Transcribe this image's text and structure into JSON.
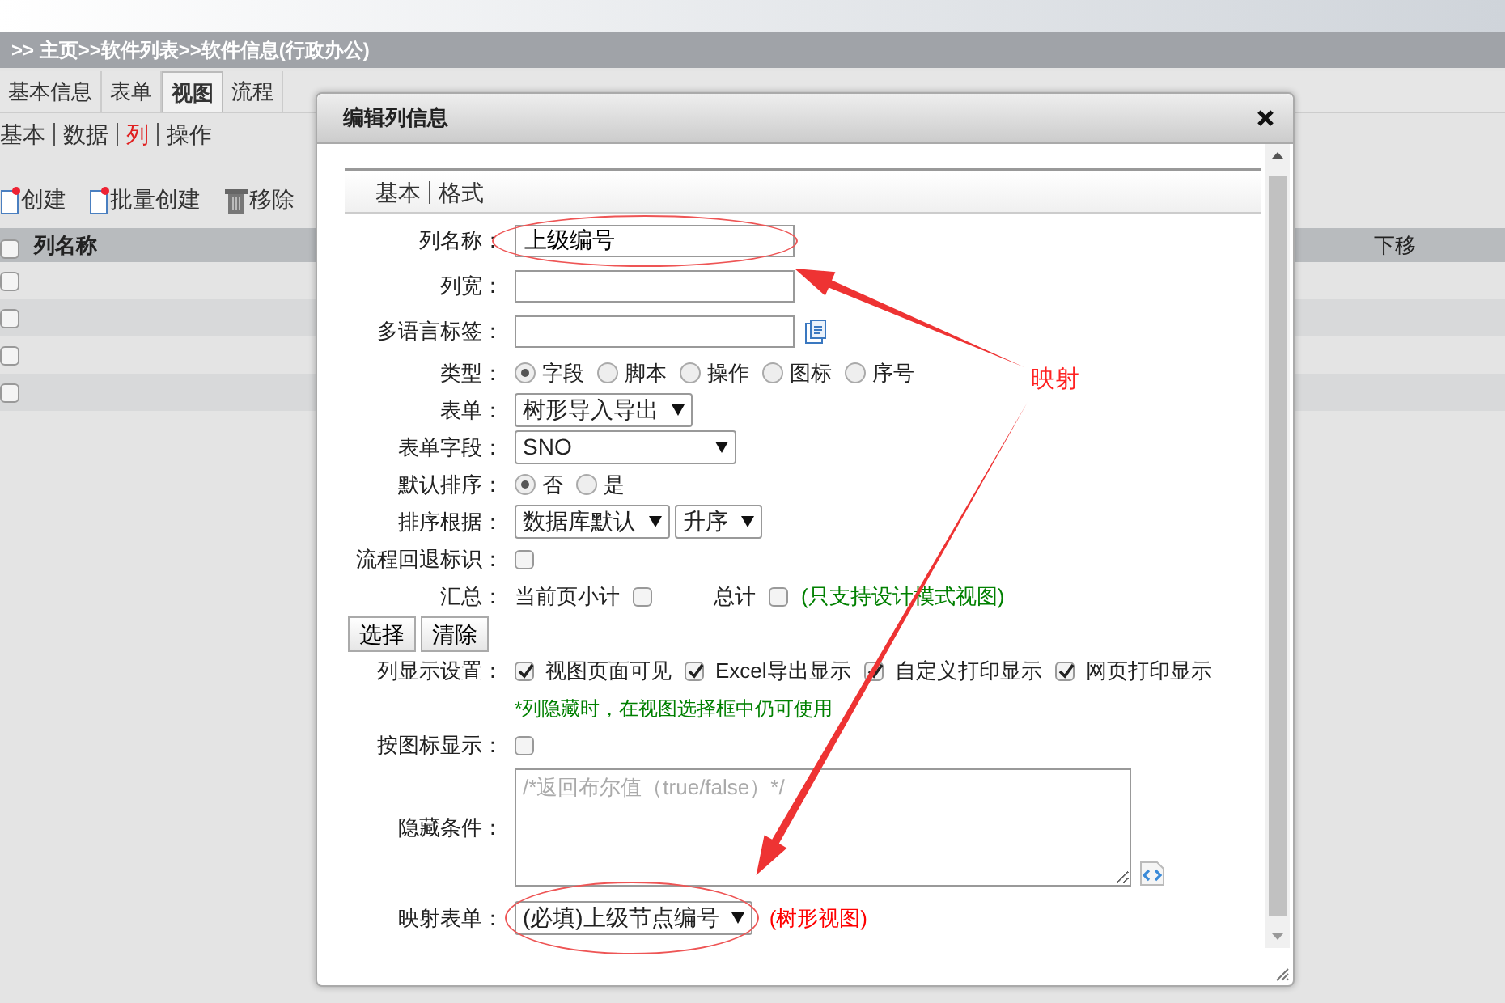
{
  "breadcrumb": ">> 主页>>软件列表>>软件信息(行政办公)",
  "tabs": [
    {
      "label": "基本信息",
      "selected": false
    },
    {
      "label": "表单",
      "selected": false
    },
    {
      "label": "视图",
      "selected": true
    },
    {
      "label": "流程",
      "selected": false
    }
  ],
  "subtabs": [
    {
      "label": "基本",
      "selected": false
    },
    {
      "label": "数据",
      "selected": false
    },
    {
      "label": "列",
      "selected": true
    },
    {
      "label": "操作",
      "selected": false
    }
  ],
  "toolbar": [
    {
      "label": "创建",
      "kind": "new"
    },
    {
      "label": "批量创建",
      "kind": "new"
    },
    {
      "label": "移除",
      "kind": "remove"
    }
  ],
  "table": {
    "header_checked": false,
    "columns": [
      "列名称",
      "下移"
    ],
    "rows": [
      {
        "checked": false
      },
      {
        "checked": false
      },
      {
        "checked": false
      },
      {
        "checked": false
      }
    ]
  },
  "dialog": {
    "title": "编辑列信息",
    "tabs": [
      "基本",
      "格式"
    ],
    "annotation": "映射",
    "fields": [
      {
        "kind": "text",
        "label": "列名称：",
        "value": "上级编号",
        "circled": true
      },
      {
        "kind": "text",
        "label": "列宽："
      },
      {
        "kind": "lookup",
        "label": "多语言标签："
      },
      {
        "kind": "radio",
        "label": "类型：",
        "options": [
          {
            "label": "字段",
            "selected": true
          },
          {
            "label": "脚本",
            "selected": false
          },
          {
            "label": "操作",
            "selected": false
          },
          {
            "label": "图标",
            "selected": false
          },
          {
            "label": "序号",
            "selected": false
          }
        ]
      },
      {
        "kind": "select",
        "label": "表单：",
        "selects": [
          "树形导入导出"
        ]
      },
      {
        "kind": "select",
        "label": "表单字段：",
        "selects": [
          "SNO"
        ]
      },
      {
        "kind": "radio",
        "label": "默认排序：",
        "options": [
          {
            "label": "否",
            "selected": true
          },
          {
            "label": "是",
            "selected": false
          }
        ]
      },
      {
        "kind": "select",
        "label": "排序根据：",
        "selects": [
          "数据库默认",
          "升序"
        ]
      },
      {
        "kind": "checks",
        "label": "流程回退标识：",
        "items": [
          {
            "checked": false
          }
        ]
      },
      {
        "kind": "tally",
        "label": "汇总：",
        "items": [
          {
            "label": "当前页小计",
            "checked": false
          },
          {
            "label": "总计",
            "checked": false
          }
        ],
        "note": {
          "text": "(只支持设计模式视图)",
          "color": "#008000"
        }
      },
      {
        "kind": "buttons",
        "buttons": [
          "选择",
          "清除"
        ]
      },
      {
        "kind": "checks",
        "label": "列显示设置：",
        "items": [
          {
            "label": "视图页面可见",
            "checked": true
          },
          {
            "label": "Excel导出显示",
            "checked": true
          },
          {
            "label": "自定义打印显示",
            "checked": true
          },
          {
            "label": "网页打印显示",
            "checked": true
          }
        ],
        "hint": {
          "text": "*列隐藏时，在视图选择框中仍可使用",
          "color": "#008000"
        }
      },
      {
        "kind": "checks",
        "label": "按图标显示：",
        "items": [
          {
            "checked": false
          }
        ]
      },
      {
        "kind": "textarea",
        "label": "隐藏条件：",
        "placeholder": "/*返回布尔值（true/false）*/"
      },
      {
        "kind": "select",
        "label": "映射表单：",
        "selects": [
          "(必填)上级节点编号"
        ],
        "circled": true,
        "note": {
          "text": "(树形视图)",
          "color": "#ff0000"
        }
      }
    ]
  }
}
